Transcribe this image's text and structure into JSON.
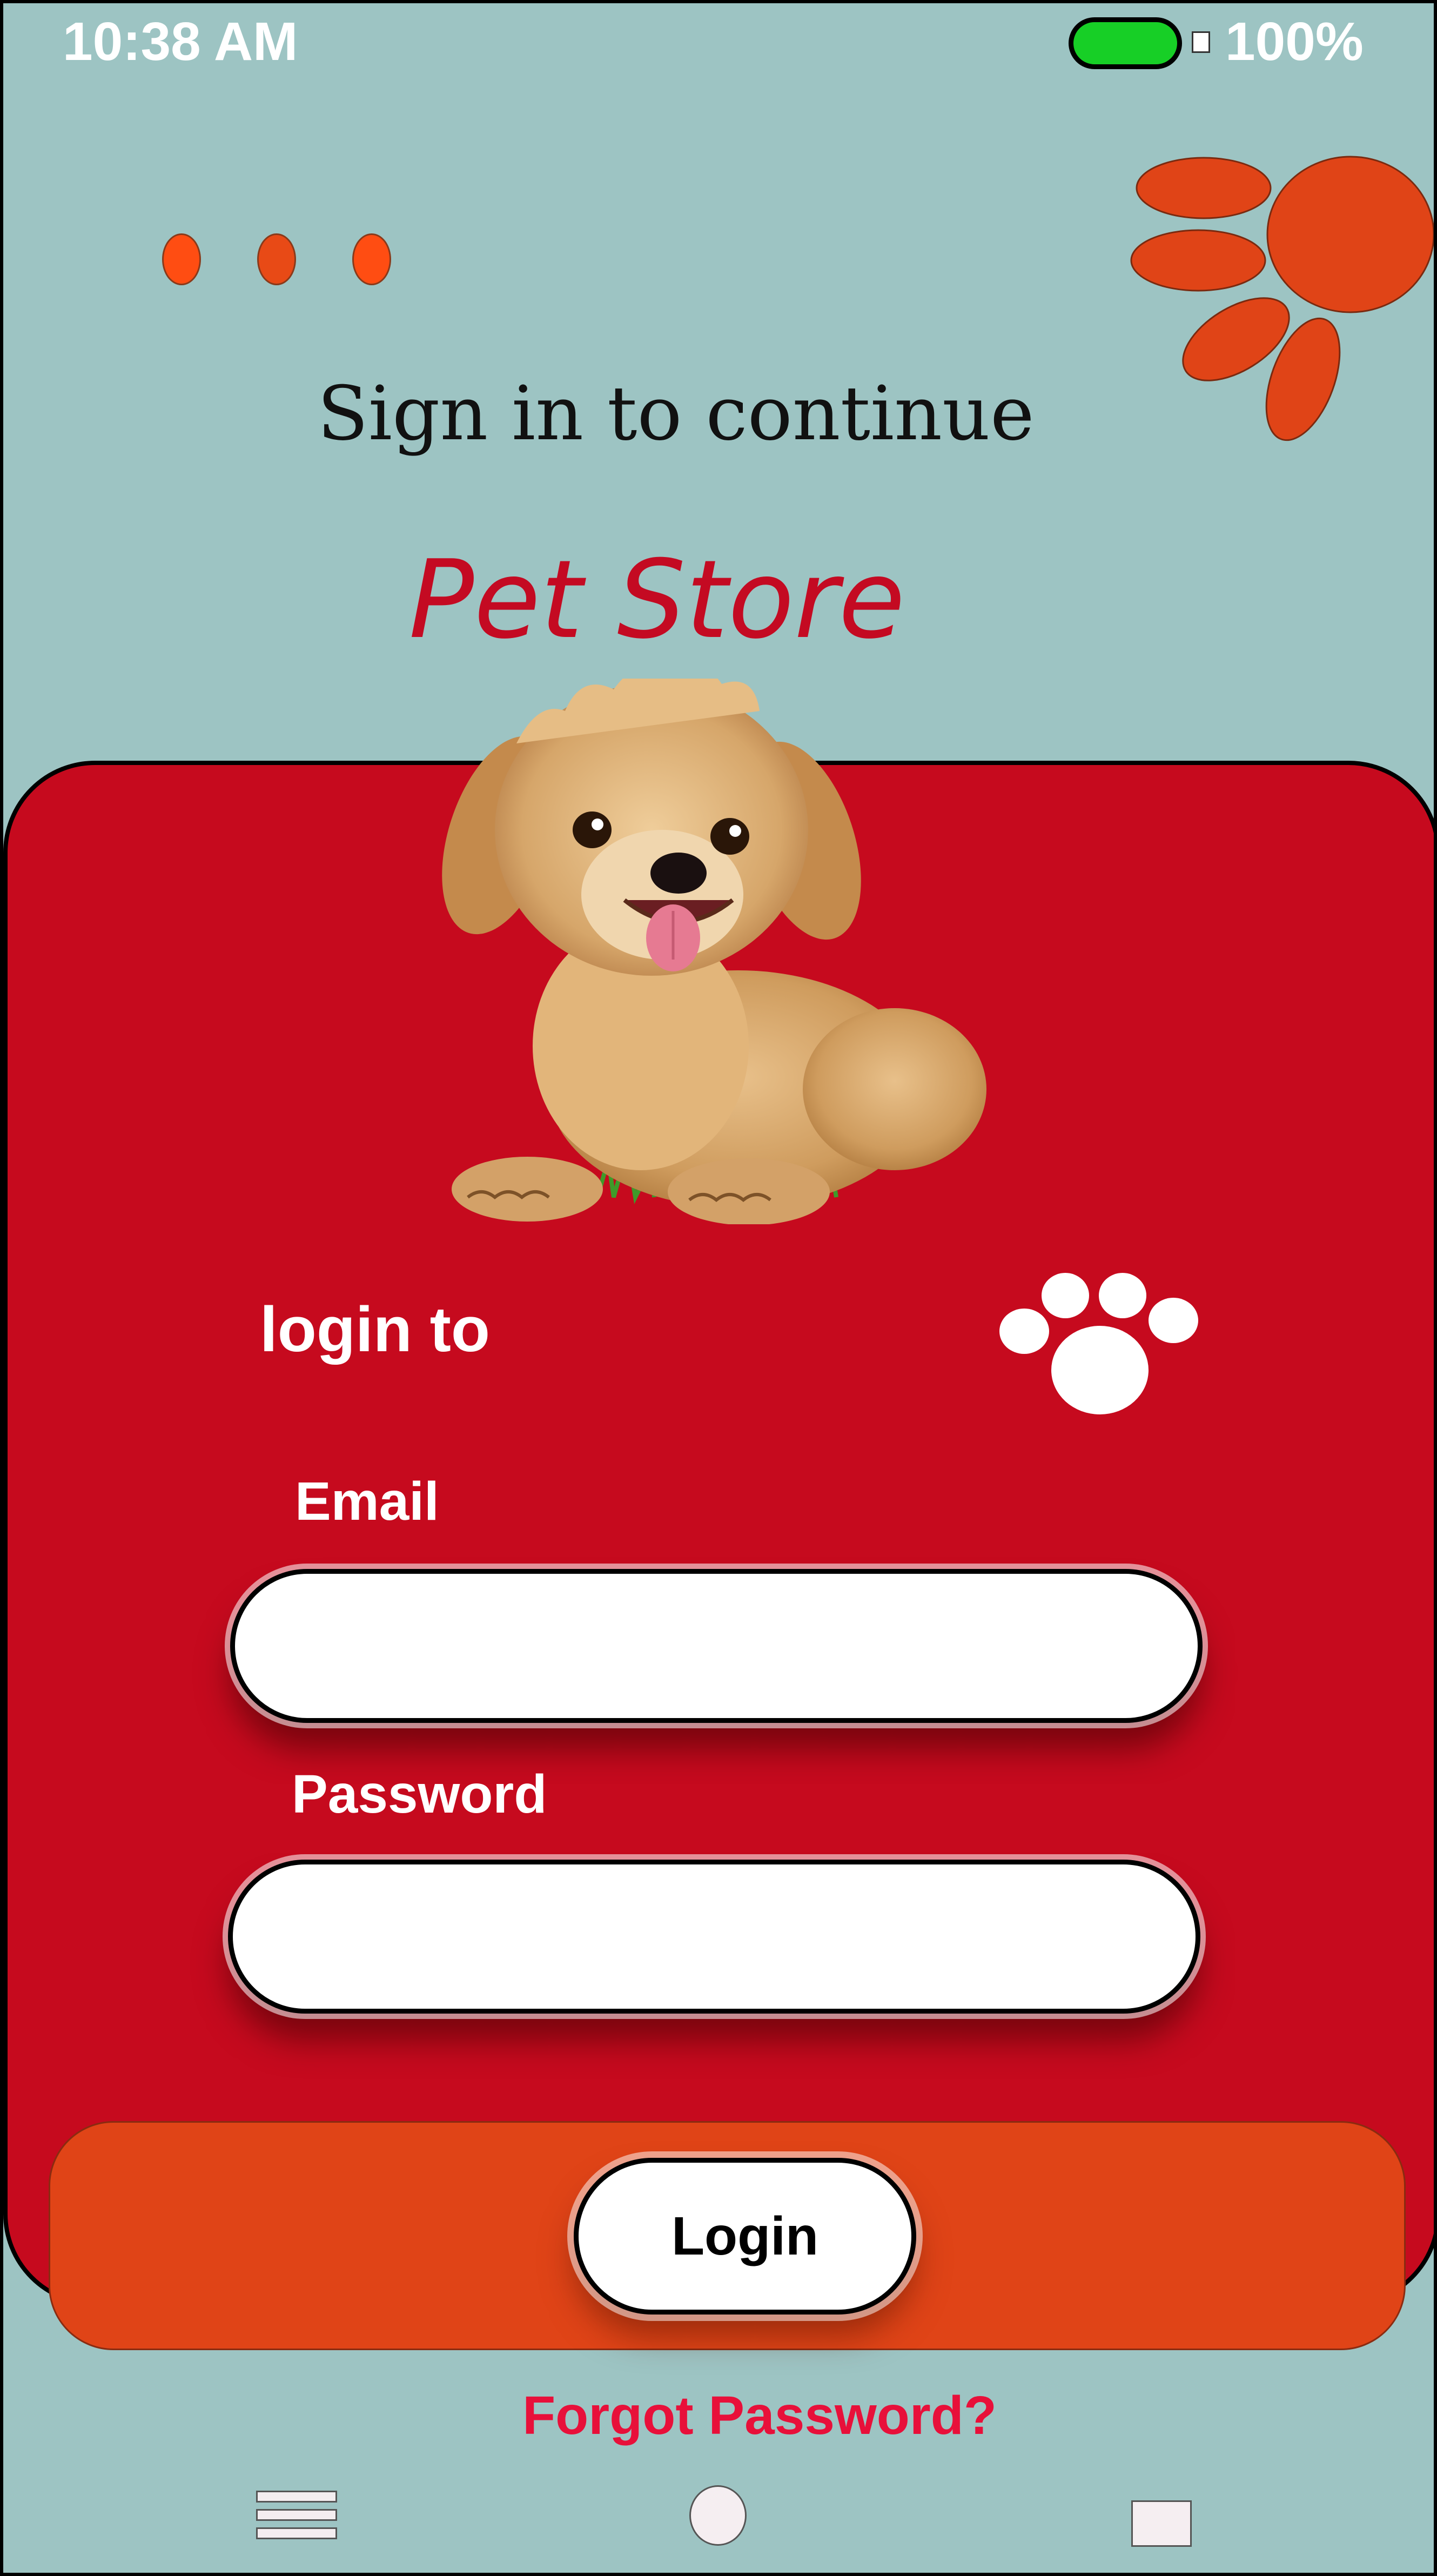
{
  "status_bar": {
    "time": "10:38 AM",
    "battery_percent": "100%",
    "battery_level": 1.0
  },
  "header": {
    "more_icon": "three-dots-icon",
    "paw_icon": "paw-print-icon",
    "subtitle": "Sign in to continue",
    "store_name": "Pet Store"
  },
  "hero": {
    "image": "puppy-illustration"
  },
  "login_card": {
    "heading": "login to",
    "heading_icon": "paw-print-icon",
    "email_label": "Email",
    "email_value": "",
    "password_label": "Password",
    "password_value": ""
  },
  "actions": {
    "login_label": "Login",
    "forgot_label": "Forgot Password?"
  },
  "nav_bar": {
    "menu_icon": "menu-icon",
    "home_icon": "home-circle-icon",
    "recent_icon": "recent-apps-icon"
  },
  "colors": {
    "background": "#9dc4c3",
    "card": "#c60a1e",
    "accent_orange": "#e04417",
    "title_red": "#c40a22",
    "link_red": "#e8103a",
    "battery_green": "#17cf26"
  }
}
